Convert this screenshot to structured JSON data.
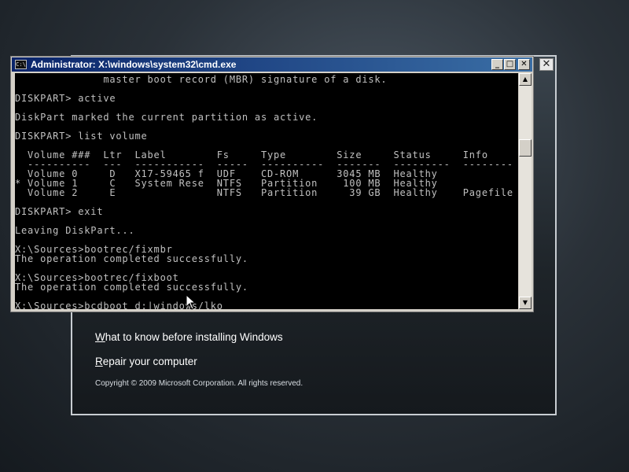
{
  "setup": {
    "close_glyph": "✕",
    "link1_first": "W",
    "link1_rest": "hat to know before installing Windows",
    "link2_first": "R",
    "link2_rest": "epair your computer",
    "copyright": "Copyright © 2009 Microsoft Corporation. All rights reserved."
  },
  "cmd": {
    "icon_text": "C:\\",
    "title": "Administrator: X:\\windows\\system32\\cmd.exe",
    "min_glyph": "_",
    "max_glyph": "□",
    "close_glyph": "✕",
    "lines": [
      "              master boot record (MBR) signature of a disk.",
      "",
      "DISKPART> active",
      "",
      "DiskPart marked the current partition as active.",
      "",
      "DISKPART> list volume",
      "",
      "  Volume ###  Ltr  Label        Fs     Type        Size     Status     Info",
      "  ----------  ---  -----------  -----  ----------  -------  ---------  --------",
      "  Volume 0     D   X17-59465 f  UDF    CD-ROM      3045 MB  Healthy",
      "* Volume 1     C   System Rese  NTFS   Partition    100 MB  Healthy",
      "  Volume 2     E                NTFS   Partition     39 GB  Healthy    Pagefile",
      "",
      "DISKPART> exit",
      "",
      "Leaving DiskPart...",
      "",
      "X:\\Sources>bootrec/fixmbr",
      "The operation completed successfully.",
      "",
      "X:\\Sources>bootrec/fixboot",
      "The operation completed successfully.",
      "",
      "X:\\Sources>bcdboot d:|windows/lko _"
    ],
    "scroll_up": "▲",
    "scroll_down": "▼"
  }
}
